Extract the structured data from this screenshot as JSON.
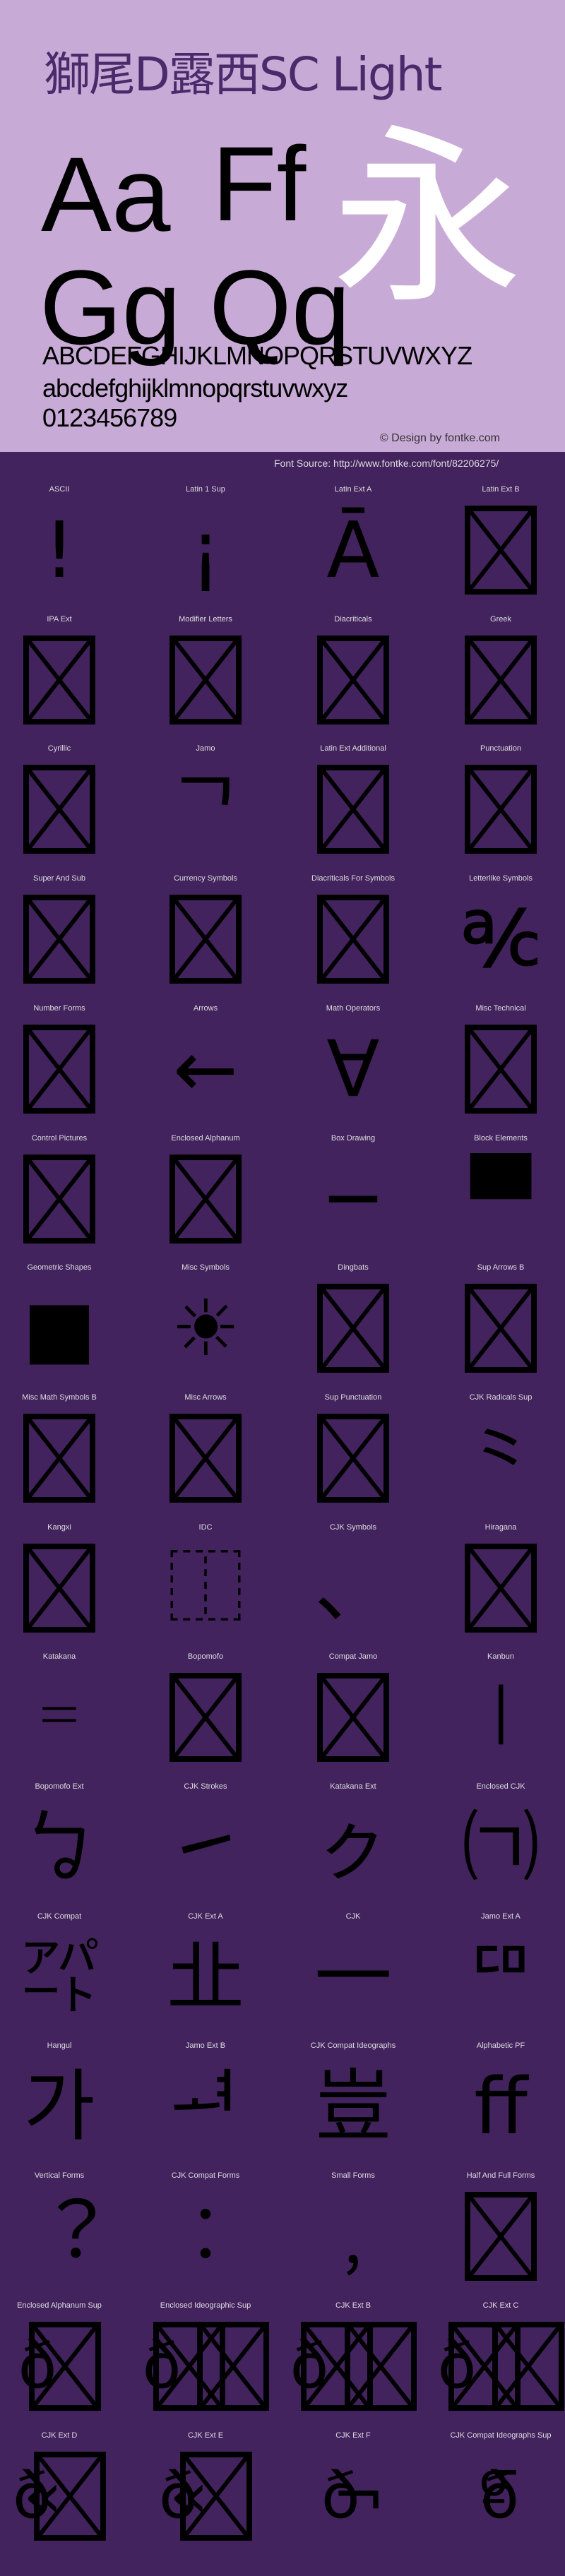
{
  "header": {
    "title": "獅尾D露西SC Light",
    "samples": [
      "Aa",
      "Ff",
      "Gg",
      "Qq"
    ],
    "hero_char": "永",
    "uppercase": "ABCDEFGHIJKLMNOPQRSTUVWXYZ",
    "lowercase": "abcdefghijklmnopqrstuvwxyz",
    "digits": "0123456789",
    "copyright": "© Design by fontke.com",
    "source": "Font Source: http://www.fontke.com/font/82206275/"
  },
  "colors": {
    "header_bg": "#c8aad6",
    "title": "#4a2a6a",
    "body_bg": "#43235e",
    "label": "#dddddd",
    "hero": "#ffffff"
  },
  "blocks": [
    {
      "label": "ASCII",
      "glyph": [
        "!"
      ]
    },
    {
      "label": "Latin 1 Sup",
      "glyph": [
        "¡"
      ]
    },
    {
      "label": "Latin Ext A",
      "glyph": [
        "Ā"
      ]
    },
    {
      "label": "Latin Ext B",
      "glyph": [
        "#tofu"
      ]
    },
    {
      "label": "IPA Ext",
      "glyph": [
        "#tofu"
      ]
    },
    {
      "label": "Modifier Letters",
      "glyph": [
        "#tofu"
      ]
    },
    {
      "label": "Diacriticals",
      "glyph": [
        "#tofu"
      ]
    },
    {
      "label": "Greek",
      "glyph": [
        "#tofu"
      ]
    },
    {
      "label": "Cyrillic",
      "glyph": [
        "#tofu"
      ]
    },
    {
      "label": "Jamo",
      "glyph": [
        "ᄀ"
      ]
    },
    {
      "label": "Latin Ext Additional",
      "glyph": [
        "#tofu"
      ]
    },
    {
      "label": "Punctuation",
      "glyph": [
        "#tofu"
      ]
    },
    {
      "label": "Super And Sub",
      "glyph": [
        "#tofu"
      ]
    },
    {
      "label": "Currency Symbols",
      "glyph": [
        "#tofu"
      ]
    },
    {
      "label": "Diacriticals For Symbols",
      "glyph": [
        "#tofu"
      ]
    },
    {
      "label": "Letterlike Symbols",
      "glyph": [
        "℀"
      ]
    },
    {
      "label": "Number Forms",
      "glyph": [
        "#tofu"
      ]
    },
    {
      "label": "Arrows",
      "glyph": [
        "←"
      ]
    },
    {
      "label": "Math Operators",
      "glyph": [
        "∀"
      ]
    },
    {
      "label": "Misc Technical",
      "glyph": [
        "#tofu"
      ]
    },
    {
      "label": "Control Pictures",
      "glyph": [
        "#tofu"
      ]
    },
    {
      "label": "Enclosed Alphanum",
      "glyph": [
        "#tofu"
      ]
    },
    {
      "label": "Box Drawing",
      "glyph": [
        "─"
      ]
    },
    {
      "label": "Block Elements",
      "glyph": [
        "▀"
      ]
    },
    {
      "label": "Geometric Shapes",
      "glyph": [
        "■"
      ]
    },
    {
      "label": "Misc Symbols",
      "glyph": [
        "☀"
      ]
    },
    {
      "label": "Dingbats",
      "glyph": [
        "#tofu"
      ]
    },
    {
      "label": "Sup Arrows B",
      "glyph": [
        "#tofu"
      ]
    },
    {
      "label": "Misc Math Symbols B",
      "glyph": [
        "#tofu"
      ]
    },
    {
      "label": "Misc Arrows",
      "glyph": [
        "#tofu"
      ]
    },
    {
      "label": "Sup Punctuation",
      "glyph": [
        "#tofu"
      ]
    },
    {
      "label": "CJK Radicals Sup",
      "glyph": [
        "⺀"
      ]
    },
    {
      "label": "Kangxi",
      "glyph": [
        "#tofu"
      ]
    },
    {
      "label": "IDC",
      "glyph": [
        "⿰"
      ]
    },
    {
      "label": "CJK Symbols",
      "glyph": [
        "、"
      ]
    },
    {
      "label": "Hiragana",
      "glyph": [
        "#tofu"
      ]
    },
    {
      "label": "Katakana",
      "glyph": [
        "゠"
      ]
    },
    {
      "label": "Bopomofo",
      "glyph": [
        "#tofu"
      ]
    },
    {
      "label": "Compat Jamo",
      "glyph": [
        "#tofu"
      ]
    },
    {
      "label": "Kanbun",
      "glyph": [
        "㆐"
      ]
    },
    {
      "label": "Bopomofo Ext",
      "glyph": [
        "ㆠ"
      ]
    },
    {
      "label": "CJK Strokes",
      "glyph": [
        "㇀"
      ]
    },
    {
      "label": "Katakana Ext",
      "glyph": [
        "ㇰ"
      ]
    },
    {
      "label": "Enclosed CJK",
      "glyph": [
        "㈀"
      ]
    },
    {
      "label": "CJK Compat",
      "glyph": [
        "㌀"
      ]
    },
    {
      "label": "CJK Ext A",
      "glyph": [
        "㐀"
      ]
    },
    {
      "label": "CJK",
      "glyph": [
        "一"
      ]
    },
    {
      "label": "Jamo Ext A",
      "glyph": [
        "ꥠ"
      ]
    },
    {
      "label": "Hangul",
      "glyph": [
        "가"
      ]
    },
    {
      "label": "Jamo Ext B",
      "glyph": [
        "ힰ"
      ]
    },
    {
      "label": "CJK Compat Ideographs",
      "glyph": [
        "豈"
      ]
    },
    {
      "label": "Alphabetic PF",
      "glyph": [
        "ﬀ"
      ]
    },
    {
      "label": "Vertical Forms",
      "glyph": [
        "︖"
      ]
    },
    {
      "label": "CJK Compat Forms",
      "glyph": [
        "︰"
      ]
    },
    {
      "label": "Small Forms",
      "glyph": [
        "﹐"
      ]
    },
    {
      "label": "Half And Full Forms",
      "glyph": [
        "#tofu"
      ]
    },
    {
      "label": "Enclosed Alphanum Sup",
      "glyph": [
        "ð",
        "#tofu"
      ]
    },
    {
      "label": "Enclosed Ideographic Sup",
      "glyph": [
        "ð",
        "#tofu",
        "#tofu"
      ]
    },
    {
      "label": "CJK Ext B",
      "glyph": [
        "ð",
        "#tofu",
        "#tofu"
      ]
    },
    {
      "label": "CJK Ext C",
      "glyph": [
        "ð",
        "#tofu",
        "#tofu"
      ]
    },
    {
      "label": "CJK Ext D",
      "glyph": [
        "ð",
        "«",
        "#tofu"
      ]
    },
    {
      "label": "CJK Ext E",
      "glyph": [
        "ð",
        "«",
        "#tofu"
      ]
    },
    {
      "label": "CJK Ext F",
      "glyph": [
        "ð",
        "¬"
      ]
    },
    {
      "label": "CJK Compat Ideographs Sup",
      "glyph": [
        "º",
        "ð",
        "¯"
      ]
    }
  ]
}
